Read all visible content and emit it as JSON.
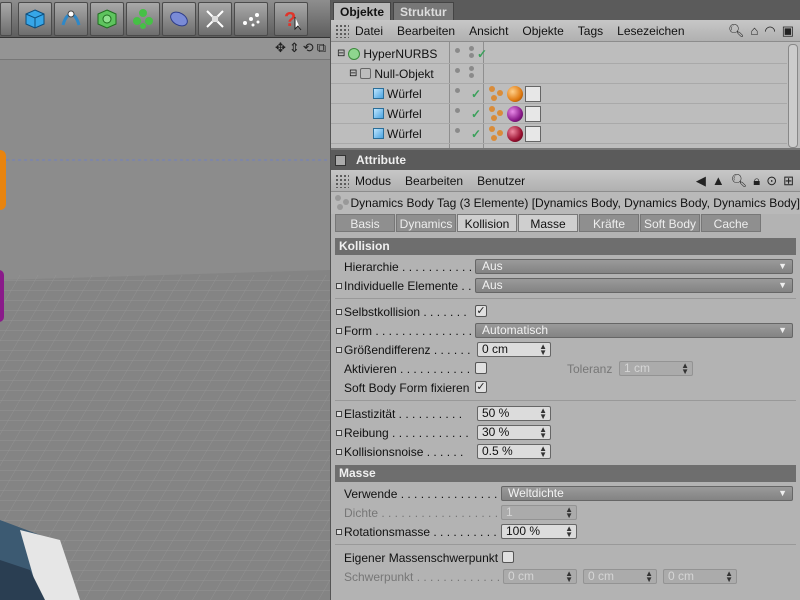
{
  "objects_panel": {
    "tabs": [
      {
        "label": "Objekte"
      },
      {
        "label": "Struktur"
      }
    ],
    "menu": [
      {
        "label": "Datei"
      },
      {
        "label": "Bearbeiten"
      },
      {
        "label": "Ansicht"
      },
      {
        "label": "Objekte"
      },
      {
        "label": "Tags"
      },
      {
        "label": "Lesezeichen"
      }
    ],
    "rows": [
      {
        "name": "HyperNURBS",
        "type": "hypernurbs"
      },
      {
        "name": "Null-Objekt",
        "type": "null"
      },
      {
        "name": "Würfel",
        "type": "cube",
        "material_color": "#e07a10"
      },
      {
        "name": "Würfel",
        "type": "cube",
        "material_color": "#8a1a8a"
      },
      {
        "name": "Würfel",
        "type": "cube",
        "material_color": "#9a1030"
      }
    ]
  },
  "attributes_panel": {
    "title": "Attribute",
    "menu": [
      {
        "label": "Modus"
      },
      {
        "label": "Bearbeiten"
      },
      {
        "label": "Benutzer"
      }
    ],
    "tag_title": "Dynamics Body Tag (3 Elemente) [Dynamics Body, Dynamics Body, Dynamics Body]",
    "subtabs": [
      {
        "label": "Basis",
        "active": false
      },
      {
        "label": "Dynamics",
        "active": false
      },
      {
        "label": "Kollision",
        "active": true
      },
      {
        "label": "Masse",
        "active": true
      },
      {
        "label": "Kräfte",
        "active": false
      },
      {
        "label": "Soft Body",
        "active": false
      },
      {
        "label": "Cache",
        "active": false
      }
    ],
    "kollision": {
      "section_label": "Kollision",
      "hierarchie": {
        "label": "Hierarchie . . . . . . . . . . .",
        "value": "Aus"
      },
      "individuelle": {
        "label": "Individuelle Elemente . .",
        "value": "Aus"
      },
      "selbstkollision": {
        "label": "Selbstkollision . . . . . . .",
        "checked": "✓"
      },
      "form": {
        "label": "Form . . . . . . . . . . . . . . .",
        "value": "Automatisch"
      },
      "groessendifferenz": {
        "label": "Größendifferenz . . . . . .",
        "value": "0 cm"
      },
      "aktivieren": {
        "label": "Aktivieren . . . . . . . . . . .",
        "checked": ""
      },
      "toleranz": {
        "label": "Toleranz",
        "value": "1 cm"
      },
      "softbody_fix": {
        "label": "Soft Body Form fixieren",
        "checked": "✓"
      },
      "elastizitaet": {
        "label": "Elastizität . . . . . . . . . .",
        "value": "50 %"
      },
      "reibung": {
        "label": "Reibung . . . . . . . . . . . .",
        "value": "30 %"
      },
      "kollisionsnoise": {
        "label": "Kollisionsnoise . . . . . .",
        "value": "0.5 %"
      }
    },
    "masse": {
      "section_label": "Masse",
      "verwende": {
        "label": "Verwende . . . . . . . . . . . . . . . . . .",
        "value": "Weltdichte"
      },
      "dichte": {
        "label": "Dichte . . . . . . . . . . . . . . . . . . . .",
        "value": "1"
      },
      "rotationsmasse": {
        "label": "Rotationsmasse . . . . . . . . . . . .",
        "value": "100 %"
      },
      "eigener": {
        "label": "Eigener Massenschwerpunkt",
        "checked": ""
      },
      "schwerpunkt": {
        "label": "Schwerpunkt . . . . . . . . . . . . . . .",
        "x": "0 cm",
        "y": "0 cm",
        "z": "0 cm"
      }
    }
  }
}
